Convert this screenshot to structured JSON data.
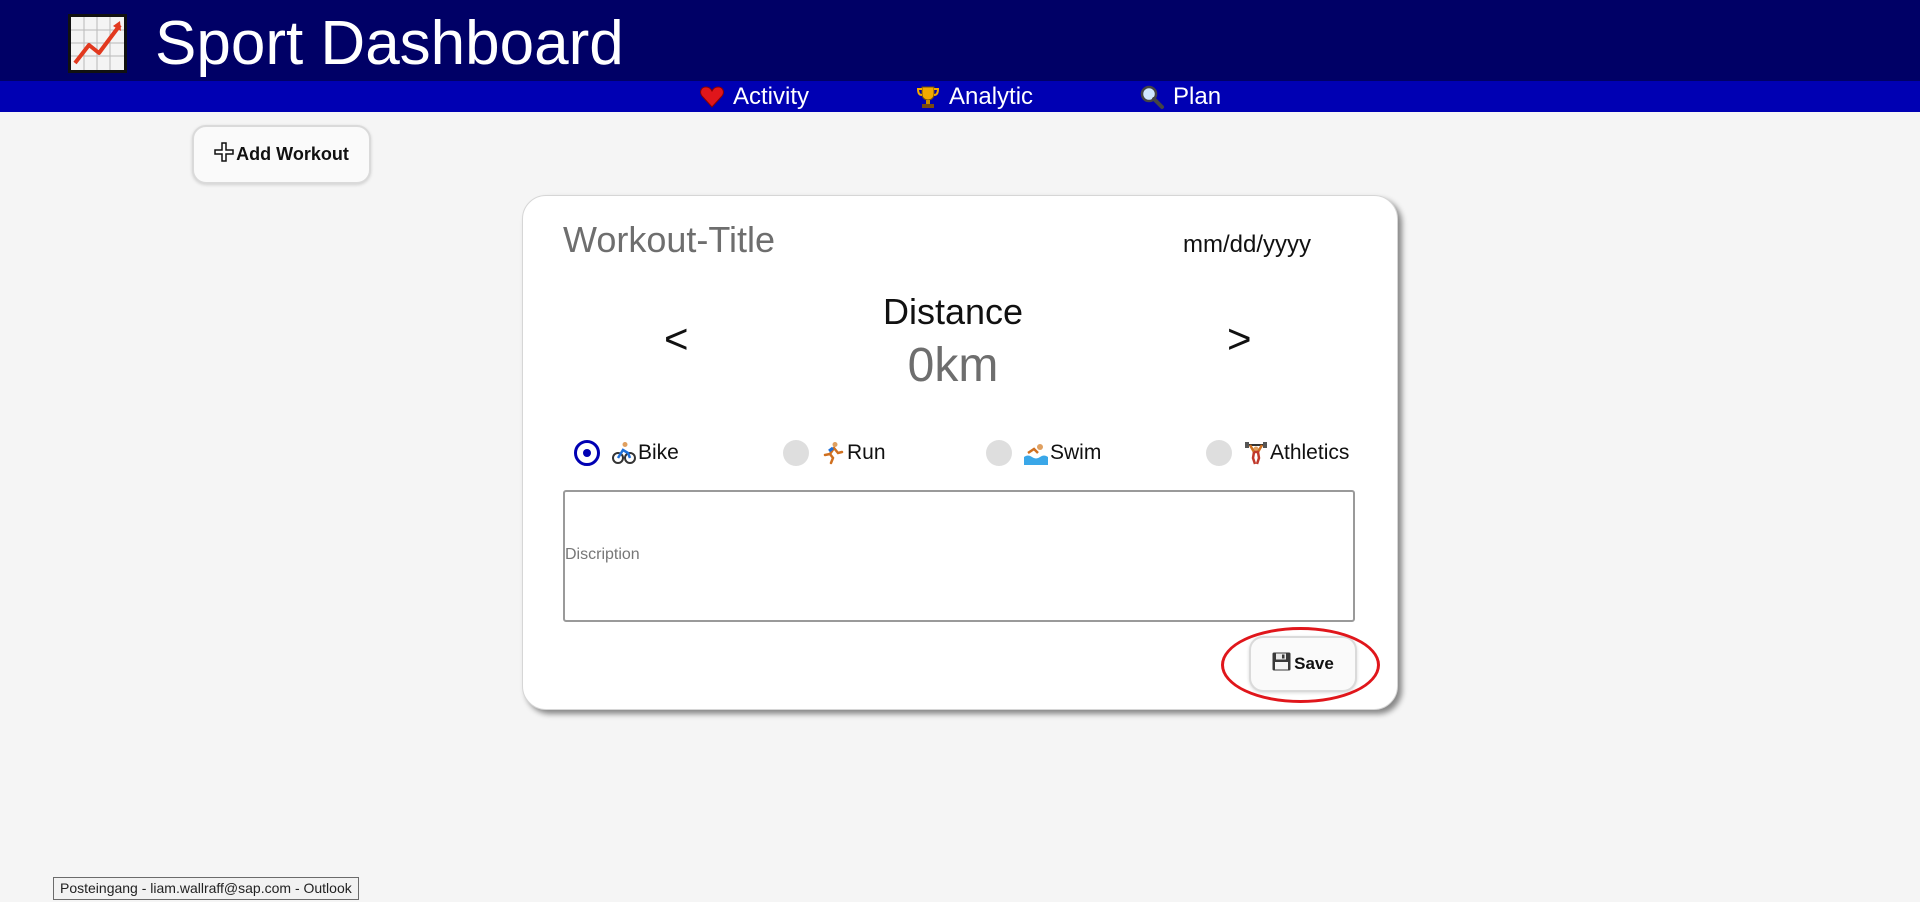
{
  "header": {
    "title": "Sport Dashboard",
    "logo_icon": "chart-increasing-icon",
    "bg_color": "#000066"
  },
  "nav": {
    "bg_color": "#0000b3",
    "items": [
      {
        "label": "Activity",
        "icon": "red-heart-icon"
      },
      {
        "label": "Analytic",
        "icon": "trophy-icon"
      },
      {
        "label": "Plan",
        "icon": "magnifying-glass-icon"
      }
    ]
  },
  "toolbar": {
    "add_workout_label": "Add Workout",
    "add_icon": "plus-icon"
  },
  "form": {
    "title_placeholder": "Workout-Title",
    "date_placeholder": "mm/dd/yyyy",
    "prev_arrow": "<",
    "next_arrow": ">",
    "metric_label": "Distance",
    "metric_value": "0km",
    "sports": [
      {
        "label": "Bike",
        "icon": "person-biking-icon",
        "selected": true
      },
      {
        "label": "Run",
        "icon": "person-running-icon",
        "selected": false
      },
      {
        "label": "Swim",
        "icon": "person-swimming-icon",
        "selected": false
      },
      {
        "label": "Athletics",
        "icon": "person-lifting-weights-icon",
        "selected": false
      }
    ],
    "description_placeholder": "Discription",
    "save_label": "Save",
    "save_icon": "floppy-disk-icon",
    "accent_color": "#0000b3"
  },
  "annotation": {
    "ring_color": "#e0161b"
  },
  "statusbar": {
    "text": "Posteingang - liam.wallraff@sap.com - Outlook"
  }
}
